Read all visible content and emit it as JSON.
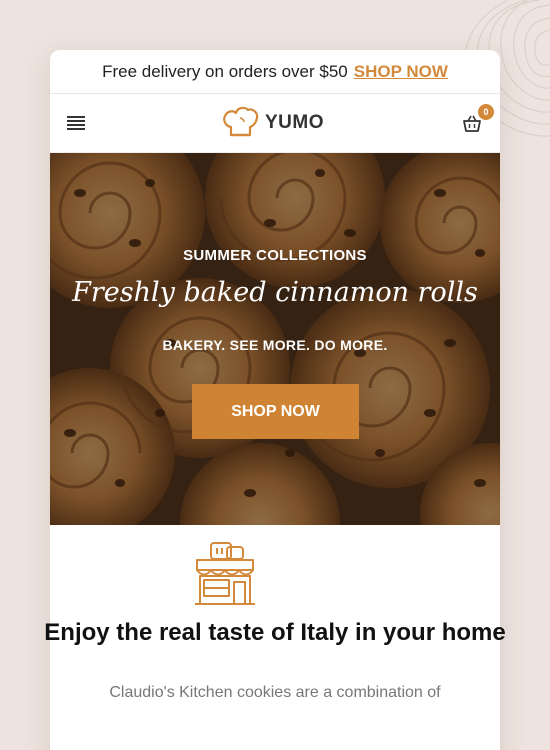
{
  "announcement": {
    "text": "Free delivery on orders over $50",
    "link": "SHOP NOW"
  },
  "header": {
    "brand": "YUMO",
    "cart_count": "0"
  },
  "hero": {
    "eyebrow": "SUMMER COLLECTIONS",
    "title": "Freshly baked cinnamon rolls",
    "subtitle": "BAKERY. SEE MORE. DO MORE.",
    "button": "SHOP NOW"
  },
  "intro": {
    "title": "Enjoy the real taste of Italy in your home",
    "text": "Claudio's Kitchen cookies are a combination of"
  },
  "colors": {
    "accent": "#d4893a",
    "button": "#cf8434",
    "background": "#ede4df"
  }
}
